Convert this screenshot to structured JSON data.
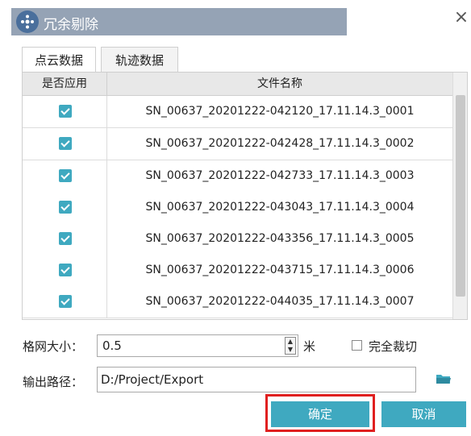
{
  "dialog": {
    "title": "冗余剔除",
    "icon": "app-logo-icon",
    "close_icon": "close-icon"
  },
  "tabs": [
    {
      "label": "点云数据",
      "active": true
    },
    {
      "label": "轨迹数据",
      "active": false
    }
  ],
  "table": {
    "headers": {
      "use": "是否应用",
      "name": "文件名称"
    },
    "rows": [
      {
        "checked": true,
        "name": "SN_00637_20201222-042120_17.11.14.3_0001"
      },
      {
        "checked": true,
        "name": "SN_00637_20201222-042428_17.11.14.3_0002"
      },
      {
        "checked": true,
        "name": "SN_00637_20201222-042733_17.11.14.3_0003"
      },
      {
        "checked": true,
        "name": "SN_00637_20201222-043043_17.11.14.3_0004"
      },
      {
        "checked": true,
        "name": "SN_00637_20201222-043356_17.11.14.3_0005"
      },
      {
        "checked": true,
        "name": "SN_00637_20201222-043715_17.11.14.3_0006"
      },
      {
        "checked": true,
        "name": "SN_00637_20201222-044035_17.11.14.3_0007"
      }
    ]
  },
  "grid": {
    "label": "格网大小：",
    "value": "0.5",
    "unit": "米"
  },
  "full_crop": {
    "label": "完全裁切",
    "checked": false
  },
  "output": {
    "label": "输出路径：",
    "value": "D:/Project/Export",
    "browse_icon": "folder-icon"
  },
  "buttons": {
    "ok": "确定",
    "cancel": "取消"
  },
  "colors": {
    "accent": "#3fa9c0",
    "title_bar": "#95a3b5",
    "highlight": "#e02020"
  }
}
